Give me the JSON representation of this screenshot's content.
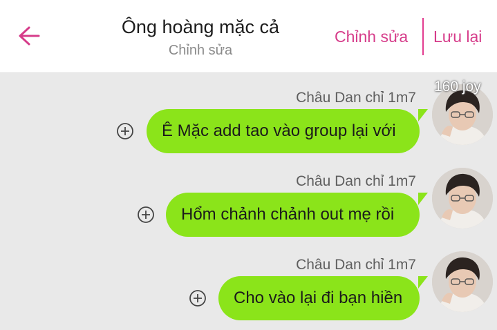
{
  "header": {
    "title": "Ông hoàng mặc cả",
    "subtitle": "Chỉnh sửa",
    "edit_label": "Chỉnh sửa",
    "save_label": "Lưu lại"
  },
  "badge": {
    "text": "160 joy"
  },
  "messages": [
    {
      "sender": "Châu Dan chỉ 1m7",
      "text": "Ê Mặc add tao vào group lại với"
    },
    {
      "sender": "Châu Dan chỉ 1m7",
      "text": "Hổm chảnh chảnh out mẹ rồi"
    },
    {
      "sender": "Châu Dan chỉ 1m7",
      "text": "Cho vào lại đi bạn hiền"
    }
  ],
  "colors": {
    "accent": "#d63c8a",
    "bubble": "#8be41a",
    "background": "#e9e9e9"
  }
}
